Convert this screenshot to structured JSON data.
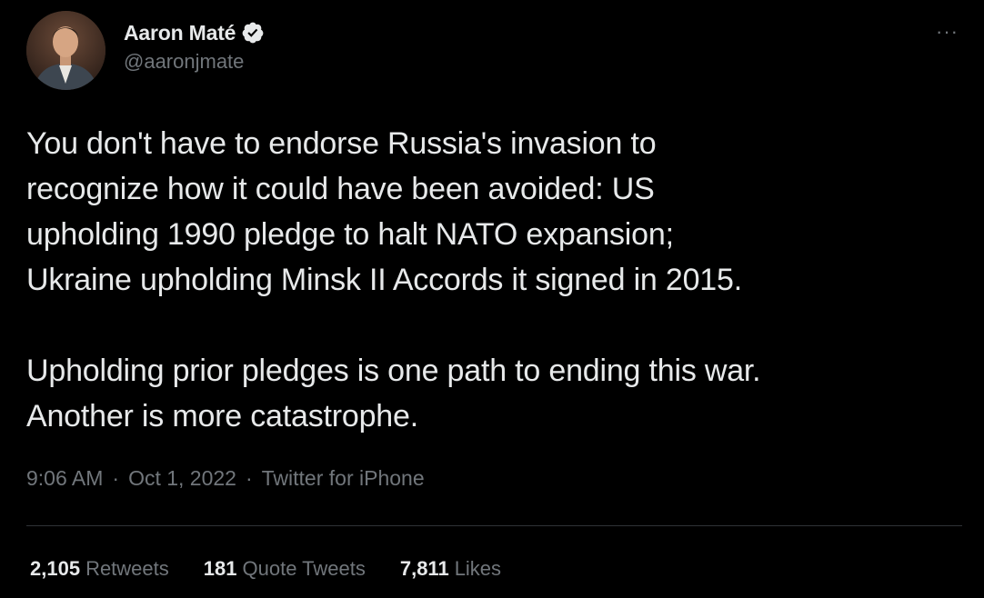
{
  "author": {
    "display_name": "Aaron Maté",
    "handle": "@aaronjmate",
    "verified_icon": "verified-badge-icon",
    "avatar_icon": "avatar-photo"
  },
  "menu": {
    "more_label": "···",
    "more_icon": "more-options-icon"
  },
  "tweet": {
    "text": "You don't have to endorse Russia's invasion to\nrecognize how it could have been avoided: US\nupholding 1990 pledge to halt NATO expansion;\nUkraine upholding Minsk II Accords it signed in 2015.\n\nUpholding prior pledges is one path to ending this war.\nAnother is more catastrophe."
  },
  "meta": {
    "time": "9:06 AM",
    "separator1": "·",
    "date": "Oct 1, 2022",
    "separator2": "·",
    "source": "Twitter for iPhone"
  },
  "stats": {
    "retweets_count": "2,105",
    "retweets_label": "Retweets",
    "quotes_count": "181",
    "quotes_label": "Quote Tweets",
    "likes_count": "7,811",
    "likes_label": "Likes"
  },
  "colors": {
    "background": "#000000",
    "text_primary": "#e7e9ea",
    "text_secondary": "#71767b",
    "verified_blue": "#1d9bf0",
    "divider": "#2f3336"
  }
}
